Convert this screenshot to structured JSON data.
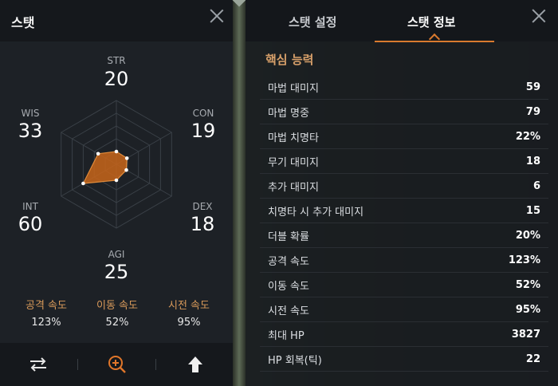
{
  "left": {
    "title": "스탯",
    "stats": [
      {
        "key": "STR",
        "value": "20"
      },
      {
        "key": "CON",
        "value": "19"
      },
      {
        "key": "DEX",
        "value": "18"
      },
      {
        "key": "AGI",
        "value": "25"
      },
      {
        "key": "INT",
        "value": "60"
      },
      {
        "key": "WIS",
        "value": "33"
      }
    ],
    "speeds": [
      {
        "label": "공격 속도",
        "value": "123%"
      },
      {
        "label": "이동 속도",
        "value": "52%"
      },
      {
        "label": "시전 속도",
        "value": "95%"
      }
    ],
    "buttons": [
      "swap-icon",
      "zoom-in-icon",
      "arrow-up-icon"
    ]
  },
  "right": {
    "tabs": [
      {
        "label": "스탯 설정",
        "active": false
      },
      {
        "label": "스탯 정보",
        "active": true
      }
    ],
    "section_title": "핵심 능력",
    "rows": [
      {
        "label": "마법 대미지",
        "value": "59"
      },
      {
        "label": "마법 명중",
        "value": "79"
      },
      {
        "label": "마법 치명타",
        "value": "22%"
      },
      {
        "label": "무기 대미지",
        "value": "18"
      },
      {
        "label": "추가 대미지",
        "value": "6"
      },
      {
        "label": "치명타 시 추가 대미지",
        "value": "15"
      },
      {
        "label": "더블 확률",
        "value": "20%"
      },
      {
        "label": "공격 속도",
        "value": "123%"
      },
      {
        "label": "이동 속도",
        "value": "52%"
      },
      {
        "label": "시전 속도",
        "value": "95%"
      },
      {
        "label": "최대 HP",
        "value": "3827"
      },
      {
        "label": "HP 회복(틱)",
        "value": "22"
      }
    ]
  },
  "colors": {
    "accent": "#d97a2e",
    "radar_fill": "#c8651a",
    "section_title": "#d8a06a"
  }
}
